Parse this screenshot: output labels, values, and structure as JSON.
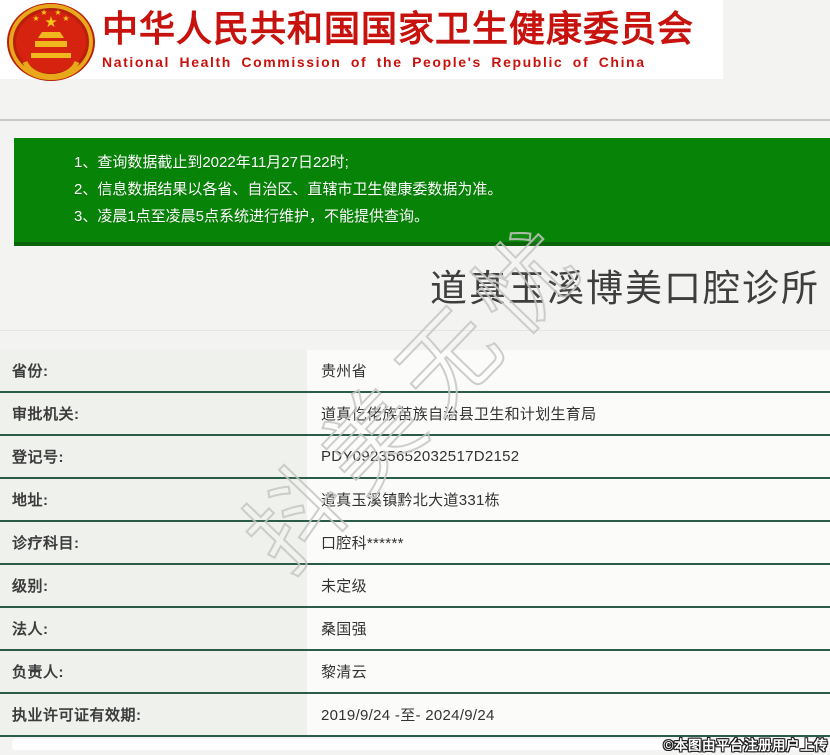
{
  "header": {
    "title_cn": "中华人民共和国国家卫生健康委员会",
    "title_en": "National Health Commission of the People's Republic of China"
  },
  "notice": {
    "items": [
      "1、查询数据截止到2022年11月27日22时;",
      "2、信息数据结果以各省、自治区、直辖市卫生健康委数据为准。",
      "3、凌晨1点至凌晨5点系统进行维护，不能提供查询。"
    ]
  },
  "result": {
    "title": "道真玉溪博美口腔诊所",
    "fields": [
      {
        "label": "省份:",
        "value": "贵州省"
      },
      {
        "label": "审批机关:",
        "value": "道真仡佬族苗族自治县卫生和计划生育局"
      },
      {
        "label": "登记号:",
        "value": "PDY09235652032517D2152"
      },
      {
        "label": "地址:",
        "value": "道真玉溪镇黔北大道331栋"
      },
      {
        "label": "诊疗科目:",
        "value": "口腔科******"
      },
      {
        "label": "级别:",
        "value": "未定级"
      },
      {
        "label": "法人:",
        "value": "桑国强"
      },
      {
        "label": "负责人:",
        "value": "黎清云"
      },
      {
        "label": "执业许可证有效期:",
        "value": "2019/9/24 -至- 2024/9/24"
      }
    ]
  },
  "watermark": "抖美无忧",
  "footer": {
    "credit": "©本图由平台注册用户上传"
  },
  "colors": {
    "brand_red": "#c8120d",
    "notice_green": "#078407",
    "notice_border_green": "#0a650a",
    "divider_green": "#2b5c4a",
    "label_cell_bg": "#eff1ed",
    "value_cell_bg": "#fbfcf9",
    "page_bg": "#f3f4f1"
  }
}
